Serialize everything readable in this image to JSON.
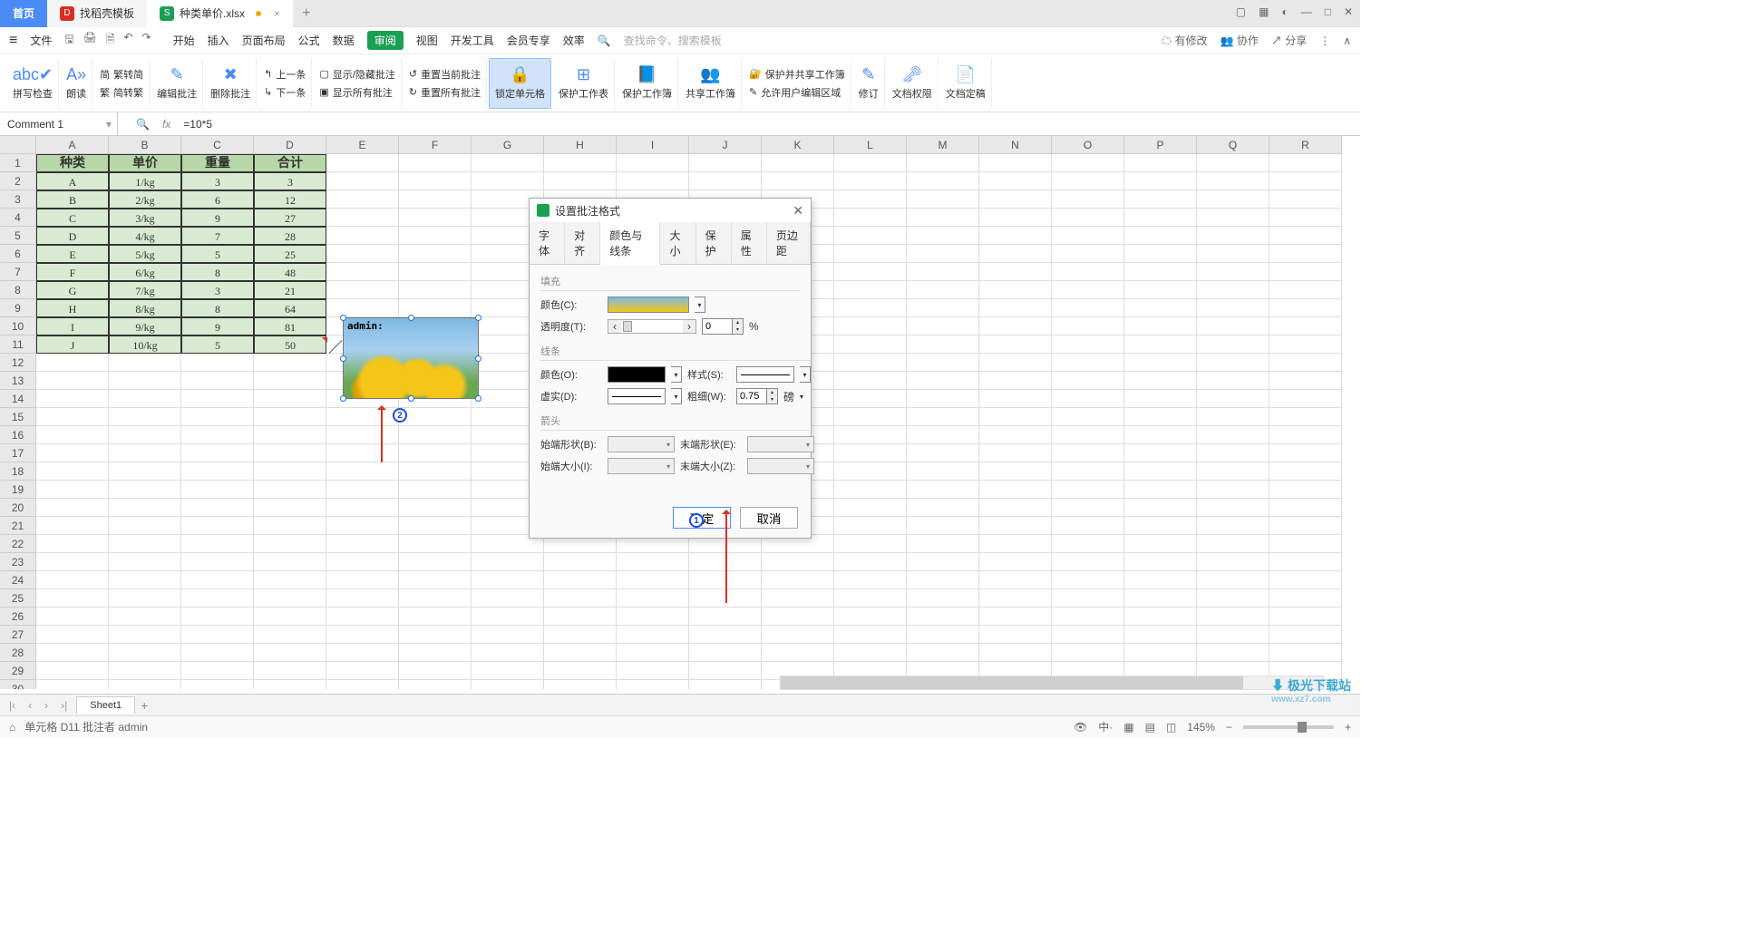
{
  "tabs": {
    "home": "首页",
    "docker": "找稻壳模板",
    "active": "种类单价.xlsx"
  },
  "menu": {
    "file": "文件",
    "items": [
      "开始",
      "插入",
      "页面布局",
      "公式",
      "数据",
      "审阅",
      "视图",
      "开发工具",
      "会员专享",
      "效率"
    ],
    "active_index": 5,
    "search_hint": "查找命令、搜索模板"
  },
  "qat_right": {
    "unsaved": "有修改",
    "coop": "协作",
    "share": "分享"
  },
  "ribbon": {
    "spellcheck": "拼写检查",
    "read": "朗读",
    "s2t": "繁转简",
    "convert": "简转繁",
    "t2s": "简转繁",
    "edit_comment": "编辑批注",
    "del_comment": "删除批注",
    "prev": "上一条",
    "next": "下一条",
    "showhide": "显示/隐藏批注",
    "showall": "显示所有批注",
    "reset_cur": "重置当前批注",
    "reset_all": "重置所有批注",
    "lock_cell": "锁定单元格",
    "protect_sheet": "保护工作表",
    "protect_book": "保护工作簿",
    "share_book": "共享工作簿",
    "protect_share": "保护并共享工作簿",
    "allow_edit": "允许用户编辑区域",
    "track": "修订",
    "doc_perm": "文档权限",
    "doc_final": "文档定稿"
  },
  "formula_bar": {
    "name": "Comment 1",
    "formula": "=10*5"
  },
  "columns": [
    "A",
    "B",
    "C",
    "D",
    "E",
    "F",
    "G",
    "H",
    "I",
    "J",
    "K",
    "L",
    "M",
    "N",
    "O",
    "P",
    "Q",
    "R"
  ],
  "table": {
    "header": [
      "种类",
      "单价",
      "重量",
      "合计"
    ],
    "rows": [
      [
        "A",
        "1/kg",
        "3",
        "3"
      ],
      [
        "B",
        "2/kg",
        "6",
        "12"
      ],
      [
        "C",
        "3/kg",
        "9",
        "27"
      ],
      [
        "D",
        "4/kg",
        "7",
        "28"
      ],
      [
        "E",
        "5/kg",
        "5",
        "25"
      ],
      [
        "F",
        "6/kg",
        "8",
        "48"
      ],
      [
        "G",
        "7/kg",
        "3",
        "21"
      ],
      [
        "H",
        "8/kg",
        "8",
        "64"
      ],
      [
        "I",
        "9/kg",
        "9",
        "81"
      ],
      [
        "J",
        "10/kg",
        "5",
        "50"
      ]
    ]
  },
  "comment_text": "admin:",
  "dialog": {
    "title": "设置批注格式",
    "tabs": [
      "字体",
      "对齐",
      "颜色与线条",
      "大小",
      "保护",
      "属性",
      "页边距"
    ],
    "active_tab": 2,
    "fill": {
      "legend": "填充",
      "color_lbl": "颜色(C):",
      "trans_lbl": "透明度(T):",
      "trans_val": "0",
      "pct": "%"
    },
    "line": {
      "legend": "线条",
      "color_lbl": "颜色(O):",
      "style_lbl": "样式(S):",
      "dash_lbl": "虚实(D):",
      "weight_lbl": "粗细(W):",
      "weight_val": "0.75",
      "weight_unit": "磅"
    },
    "arrow": {
      "legend": "箭头",
      "begin_shape": "始端形状(B):",
      "end_shape": "末端形状(E):",
      "begin_size": "始端大小(I):",
      "end_size": "末端大小(Z):"
    },
    "ok": "确定",
    "cancel": "取消"
  },
  "markers": {
    "m1": "1",
    "m2": "2"
  },
  "sheet": {
    "name": "Sheet1"
  },
  "status": {
    "text": "单元格 D11 批注者 admin",
    "zoom": "145%"
  },
  "watermark": {
    "title": "极光下载站",
    "url": "www.xz7.com"
  }
}
